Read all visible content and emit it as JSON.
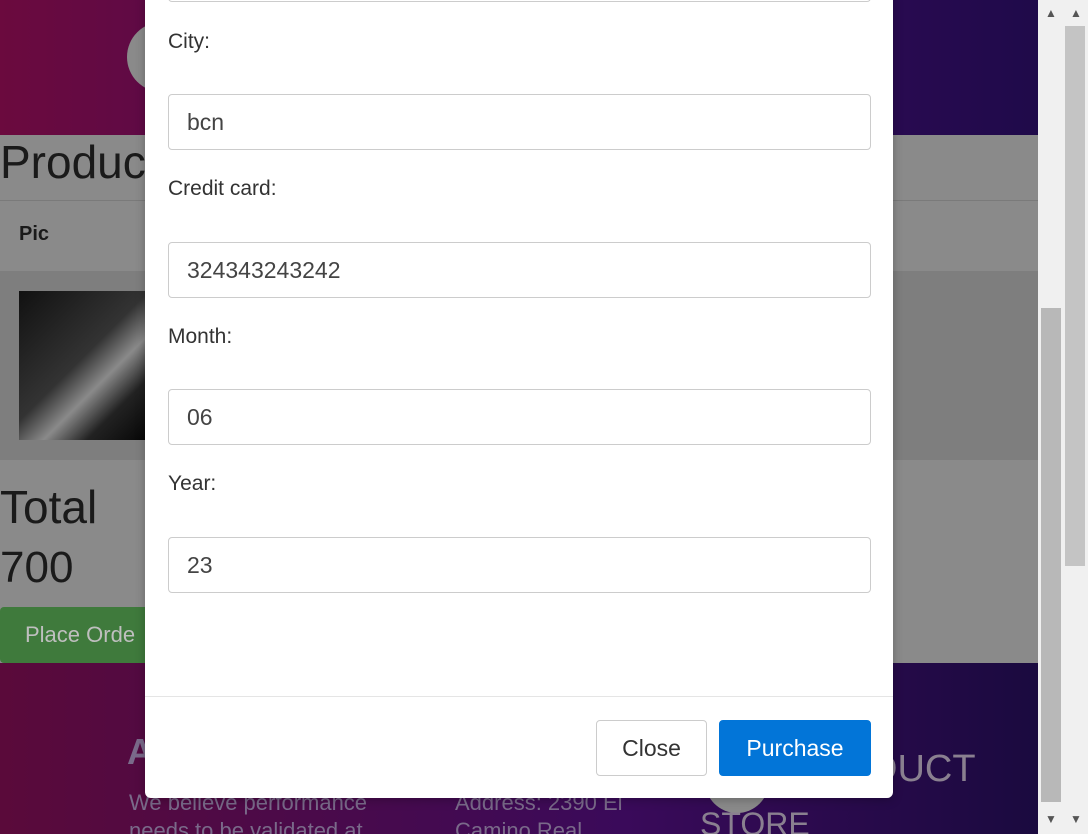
{
  "background": {
    "products_title": "Produc",
    "table_header_pic": "Pic",
    "total_label": "Total",
    "total_value": "700",
    "place_order_label": "Place Orde",
    "footer": {
      "heading": "A",
      "about_text": "We believe performance needs to be validated at",
      "address_text": "Address: 2390 El Camino Real",
      "product_text": "DUCT",
      "store_text": "STORE"
    }
  },
  "modal": {
    "fields": [
      {
        "label": "City:",
        "value": "bcn"
      },
      {
        "label": "Credit card:",
        "value": "324343243242"
      },
      {
        "label": "Month:",
        "value": "06"
      },
      {
        "label": "Year:",
        "value": "23"
      }
    ],
    "close_label": "Close",
    "purchase_label": "Purchase",
    "purchase_color": "#0275d8"
  },
  "scrollbar": {
    "up_arrow_icon": "chevron-up-icon",
    "down_arrow_icon": "chevron-down-icon"
  }
}
